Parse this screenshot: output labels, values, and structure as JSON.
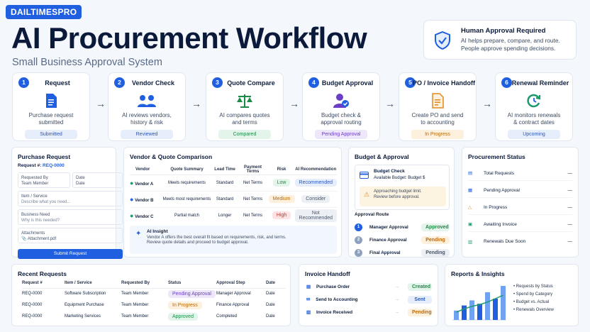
{
  "brand": "DAILTIMESPRO",
  "title": "AI Procurement Workflow",
  "subtitle": "Small Business Approval System",
  "approval_note": {
    "title": "Human Approval Required",
    "line1": "AI helps prepare, compare, and route.",
    "line2": "People approve spending decisions."
  },
  "steps": [
    {
      "num": "1",
      "name": "Request",
      "desc1": "Purchase request",
      "desc2": "submitted",
      "status": "Submitted",
      "icon": "document-icon"
    },
    {
      "num": "2",
      "name": "Vendor Check",
      "desc1": "AI reviews vendors,",
      "desc2": "history & risk",
      "status": "Reviewed",
      "icon": "people-icon"
    },
    {
      "num": "3",
      "name": "Quote Compare",
      "desc1": "AI compares quotes",
      "desc2": "and terms",
      "status": "Compared",
      "icon": "scale-icon"
    },
    {
      "num": "4",
      "name": "Budget Approval",
      "desc1": "Budget check &",
      "desc2": "approval routing",
      "status": "Pending Approval",
      "icon": "user-check-icon"
    },
    {
      "num": "5",
      "name": "PO / Invoice Handoff",
      "desc1": "Create PO and send",
      "desc2": "to accounting",
      "status": "In Progress",
      "icon": "invoice-icon"
    },
    {
      "num": "6",
      "name": "Renewal Reminder",
      "desc1": "AI monitors renewals",
      "desc2": "& contract dates",
      "status": "Upcoming",
      "icon": "refresh-icon"
    }
  ],
  "purchase_request": {
    "title": "Purchase Request",
    "req_label": "Request #:",
    "req_id": "REQ-0000",
    "requested_by_label": "Requested By",
    "requested_by_value": "Team Member",
    "date_label": "Date",
    "date_value": "Date",
    "item_label": "Item / Service",
    "item_placeholder": "Describe what you need...",
    "need_label": "Business Need",
    "need_placeholder": "Why is this needed?",
    "attachments_label": "Attachments",
    "attachment_file": "Attachment.pdf",
    "submit": "Submit Request"
  },
  "vendor_compare": {
    "title": "Vendor & Quote Comparison",
    "headers": [
      "Vendor",
      "Quote Summary",
      "Lead Time",
      "Payment Terms",
      "Risk",
      "AI Recommendation"
    ],
    "rows": [
      {
        "vendor": "Vendor A",
        "summary": "Meets requirements",
        "lead": "Standard",
        "terms": "Net Terms",
        "risk": "Low",
        "rec": "Recommended",
        "dot": "#1e9a6a"
      },
      {
        "vendor": "Vendor B",
        "summary": "Meets most requirements",
        "lead": "Standard",
        "terms": "Net Terms",
        "risk": "Medium",
        "rec": "Consider",
        "dot": "#1f5fe0"
      },
      {
        "vendor": "Vendor C",
        "summary": "Partial match",
        "lead": "Longer",
        "terms": "Net Terms",
        "risk": "High",
        "rec": "Not Recommended",
        "dot": "#1e9a6a"
      }
    ],
    "insight_title": "AI Insight",
    "insight_line1": "Vendor A offers the best overall fit based on requirements, risk, and terms.",
    "insight_line2": "Review quote details and proceed to budget approval."
  },
  "budget": {
    "title": "Budget & Approval",
    "check_title": "Budget Check",
    "available": "Available Budget:  Budget $",
    "warn1": "Approaching budget limit.",
    "warn2": "Review before approval.",
    "route_title": "Approval Route",
    "route": [
      {
        "num": "1",
        "name": "Manager Approval",
        "status": "Approved"
      },
      {
        "num": "2",
        "name": "Finance Approval",
        "status": "Pending"
      },
      {
        "num": "3",
        "name": "Final Approval",
        "status": "Pending"
      }
    ]
  },
  "procurement_status": {
    "title": "Procurement Status",
    "items": [
      {
        "label": "Total Requests",
        "value": "—"
      },
      {
        "label": "Pending Approval",
        "value": "—"
      },
      {
        "label": "In Progress",
        "value": "—"
      },
      {
        "label": "Awaiting Invoice",
        "value": "—"
      },
      {
        "label": "Renewals Due Soon",
        "value": "—"
      }
    ]
  },
  "recent_requests": {
    "title": "Recent Requests",
    "headers": [
      "Request #",
      "Item / Service",
      "Requested By",
      "Status",
      "Approval Step",
      "Date"
    ],
    "rows": [
      {
        "id": "REQ-0000",
        "item": "Software Subscription",
        "by": "Team Member",
        "status": "Pending Approval",
        "step": "Manager Approval",
        "date": "Date"
      },
      {
        "id": "REQ-0000",
        "item": "Equipment Purchase",
        "by": "Team Member",
        "status": "In Progress",
        "step": "Finance Approval",
        "date": "Date"
      },
      {
        "id": "REQ-0000",
        "item": "Marketing Services",
        "by": "Team Member",
        "status": "Approved",
        "step": "Completed",
        "date": "Date"
      }
    ]
  },
  "invoice_handoff": {
    "title": "Invoice Handoff",
    "rows": [
      {
        "label": "Purchase Order",
        "status": "Created"
      },
      {
        "label": "Send to Accounting",
        "status": "Sent"
      },
      {
        "label": "Invoice Received",
        "status": "Pending"
      }
    ]
  },
  "reports": {
    "title": "Reports & Insights",
    "items": [
      "Requests by Status",
      "Spend by Category",
      "Budget vs. Actual",
      "Renewals Overview"
    ],
    "chart_data": {
      "type": "bar",
      "values": [
        22,
        34,
        46,
        38,
        65,
        50,
        80
      ],
      "trend": [
        18,
        26,
        32,
        36,
        42,
        50,
        58
      ]
    }
  },
  "colors": {
    "primary": "#1f5fe0",
    "success": "#1e8a47",
    "warning": "#b9690c",
    "danger": "#cc2e2e"
  }
}
